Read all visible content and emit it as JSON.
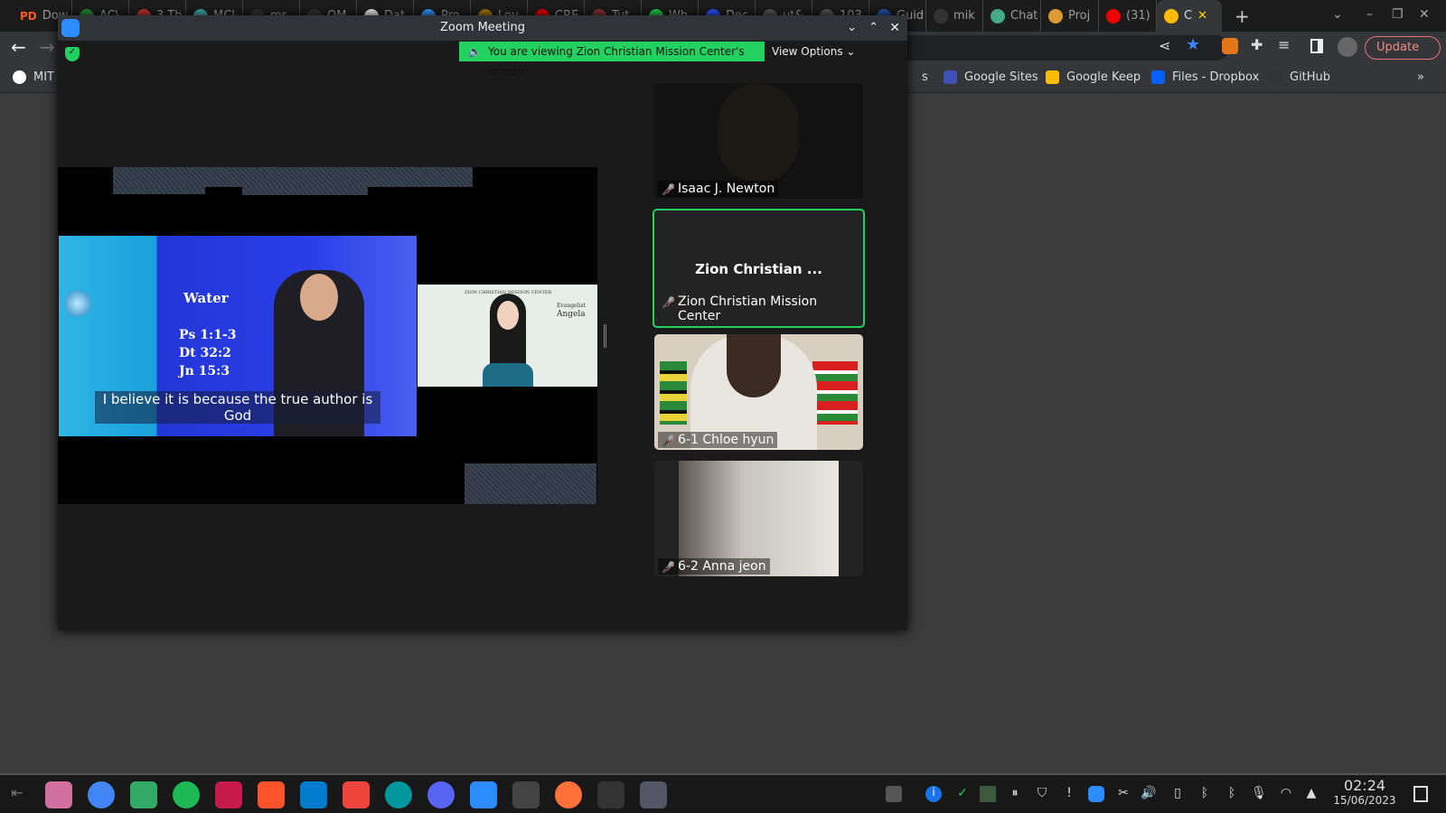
{
  "browser": {
    "tabs": [
      "Dow",
      "AC\\",
      "3 Th",
      "MCl",
      "mr",
      "OM",
      "Dat",
      "Pro",
      "Lov",
      "CRE",
      "Tut",
      "Wh",
      "Dec",
      "ut&",
      "103",
      "Guid",
      "mik",
      "Chat",
      "Proj",
      "(31)",
      "C"
    ],
    "update_label": "Update",
    "bookmarks": [
      "MIT .",
      "s",
      "Google Sites",
      "Google Keep",
      "Files - Dropbox",
      "GitHub"
    ],
    "more_bookmarks": "»"
  },
  "zoom": {
    "title": "Zoom Meeting",
    "banner": "You are viewing Zion Christian Mission Center's screen",
    "view_options": "View Options",
    "slide": {
      "title": "Water",
      "refs": [
        "Ps 1:1-3",
        "Dt 32:2",
        "Jn 15:3"
      ],
      "caption": "I believe it is because the true author is God"
    },
    "inset": {
      "org": "ZION CHRISTIAN MISSION CENTER",
      "role": "Evangelist",
      "name": "Angela"
    },
    "participants": [
      {
        "name": "Isaac J. Newton",
        "color": "#121212"
      },
      {
        "name": "Zion Christian Mission Center",
        "display": "Zion Christian ...",
        "color": "#232323"
      },
      {
        "name": "6-1 Chloe hyun",
        "color": "#d8cfc0"
      },
      {
        "name": "6-2 Anna jeon",
        "color": "#c8c4bd"
      }
    ]
  },
  "taskbar": {
    "apps": [
      "files",
      "chrome",
      "screenshot",
      "spotify",
      "raspberry-pi",
      "brave",
      "vscode",
      "anydesk",
      "arduino",
      "discord",
      "zoom",
      "mplab-x-ide",
      "firefox",
      "settings",
      "cloud"
    ],
    "time": "02:24",
    "date": "15/06/2023"
  }
}
